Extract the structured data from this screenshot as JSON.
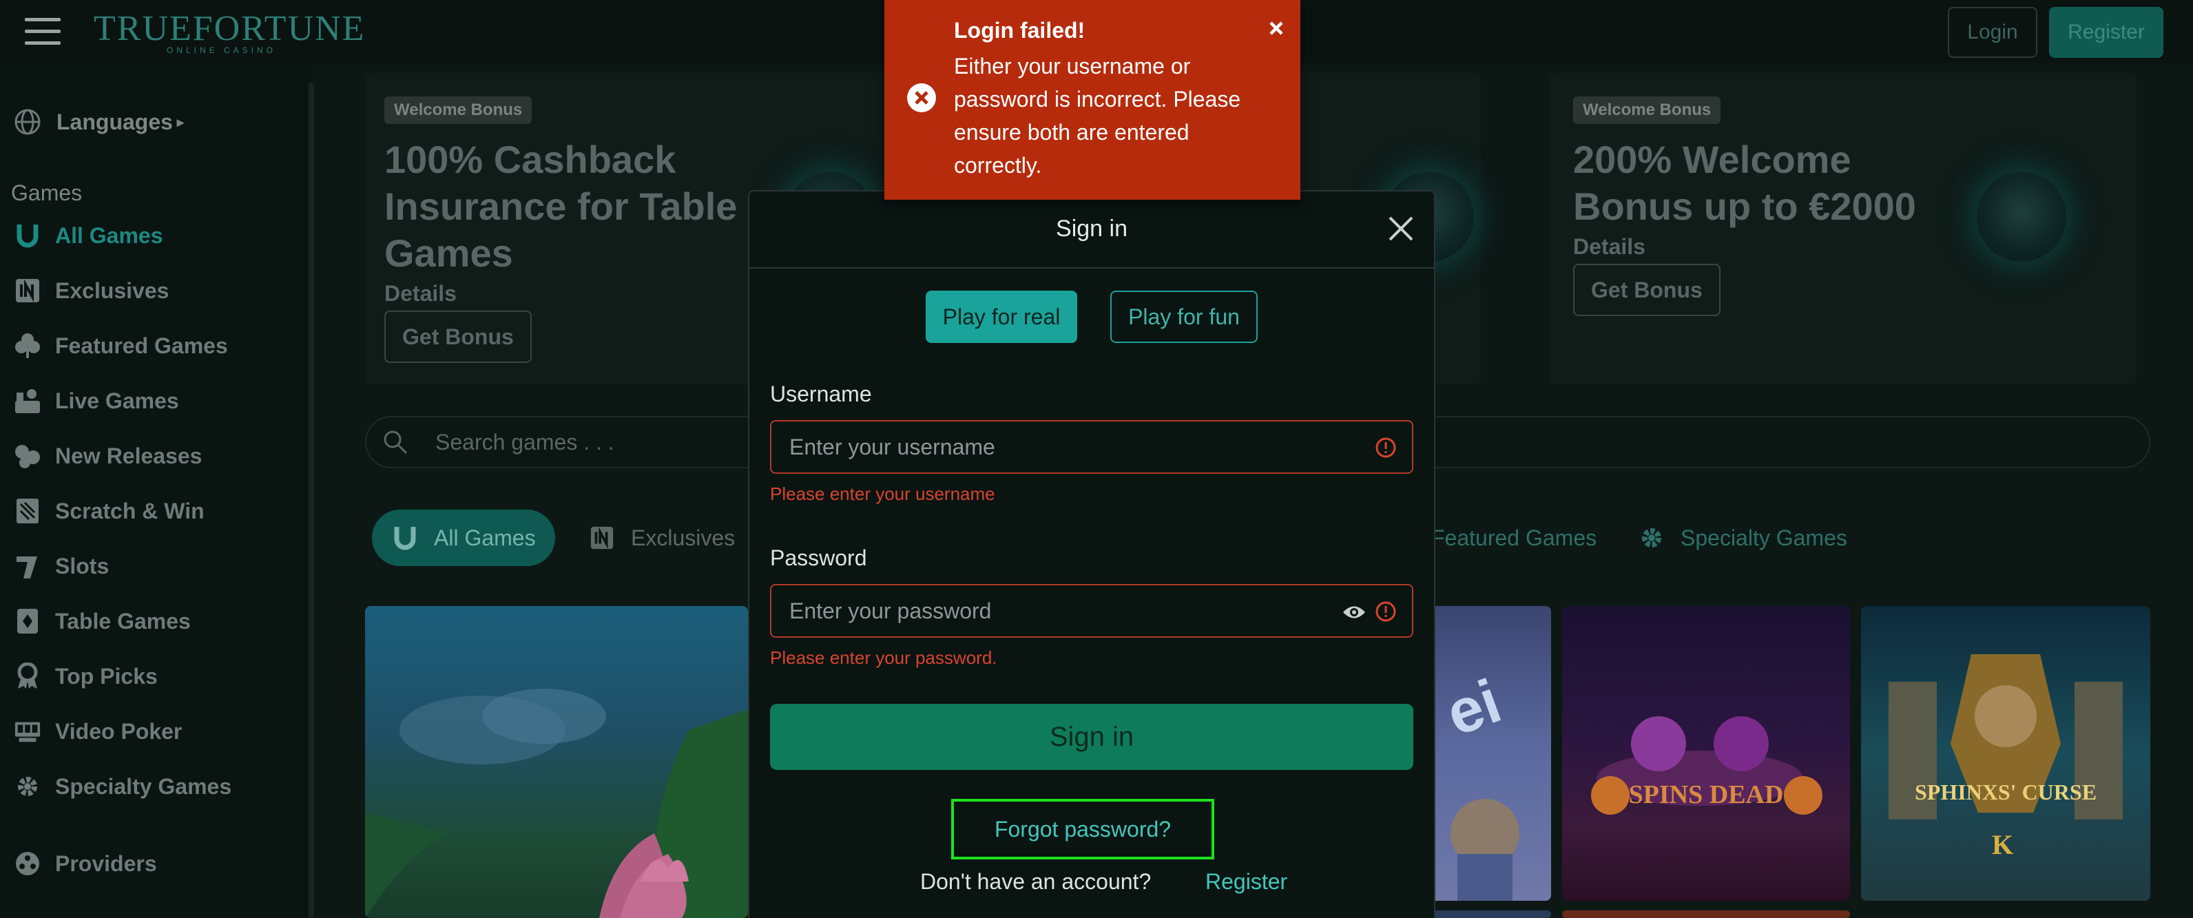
{
  "header": {
    "logo_text_1": "TRUE",
    "logo_text_2": "FORTUNE",
    "logo_sub": "ONLINE CASINO",
    "login_label": "Login",
    "register_label": "Register"
  },
  "sidebar": {
    "languages_label": "Languages",
    "games_heading": "Games",
    "items": [
      {
        "label": "All Games",
        "icon": "horseshoe-icon"
      },
      {
        "label": "Exclusives",
        "icon": "exclusive-icon"
      },
      {
        "label": "Featured Games",
        "icon": "clover-icon"
      },
      {
        "label": "Live Games",
        "icon": "dealer-icon"
      },
      {
        "label": "New Releases",
        "icon": "chips-icon"
      },
      {
        "label": "Scratch & Win",
        "icon": "scratch-card-icon"
      },
      {
        "label": "Slots",
        "icon": "slot-lever-icon"
      },
      {
        "label": "Table Games",
        "icon": "cards-icon"
      },
      {
        "label": "Top Picks",
        "icon": "award-icon"
      },
      {
        "label": "Video Poker",
        "icon": "poker-machine-icon"
      },
      {
        "label": "Specialty Games",
        "icon": "gear-icon"
      }
    ],
    "providers_label": "Providers"
  },
  "banners": [
    {
      "badge": "Welcome Bonus",
      "title": "100% Cashback Insurance for Table Games",
      "details": "Details",
      "button": "Get Bonus"
    },
    {
      "badge": "Welcome Bonus",
      "title": "200% Welcome Bonus up to €2000",
      "details": "Details",
      "button": "Get Bonus"
    }
  ],
  "search": {
    "placeholder": "Search games . . ."
  },
  "categories": [
    {
      "label": "All Games"
    },
    {
      "label": "Exclusives"
    },
    {
      "label": "Featured Games"
    },
    {
      "label": "Specialty Games"
    }
  ],
  "tiles": [
    {
      "label": ""
    },
    {
      "label": "SPINS DEAD"
    },
    {
      "label": "SPHINXS' CURSE"
    }
  ],
  "toast": {
    "title": "Login failed!",
    "message": "Either your username or password is incorrect. Please ensure both are entered correctly.",
    "color": "#b52b0c"
  },
  "modal": {
    "title": "Sign in",
    "play_real": "Play for real",
    "play_fun": "Play for fun",
    "username_label": "Username",
    "username_placeholder": "Enter your username",
    "username_error": "Please enter your username",
    "password_label": "Password",
    "password_placeholder": "Enter your password",
    "password_error": "Please enter your password.",
    "signin_button": "Sign in",
    "forgot_label": "Forgot password?",
    "no_account": "Don't have an account?",
    "register_link": "Register"
  },
  "colors": {
    "accent": "#1aa39a",
    "error": "#d9442e",
    "signin": "#0e7c5a"
  }
}
